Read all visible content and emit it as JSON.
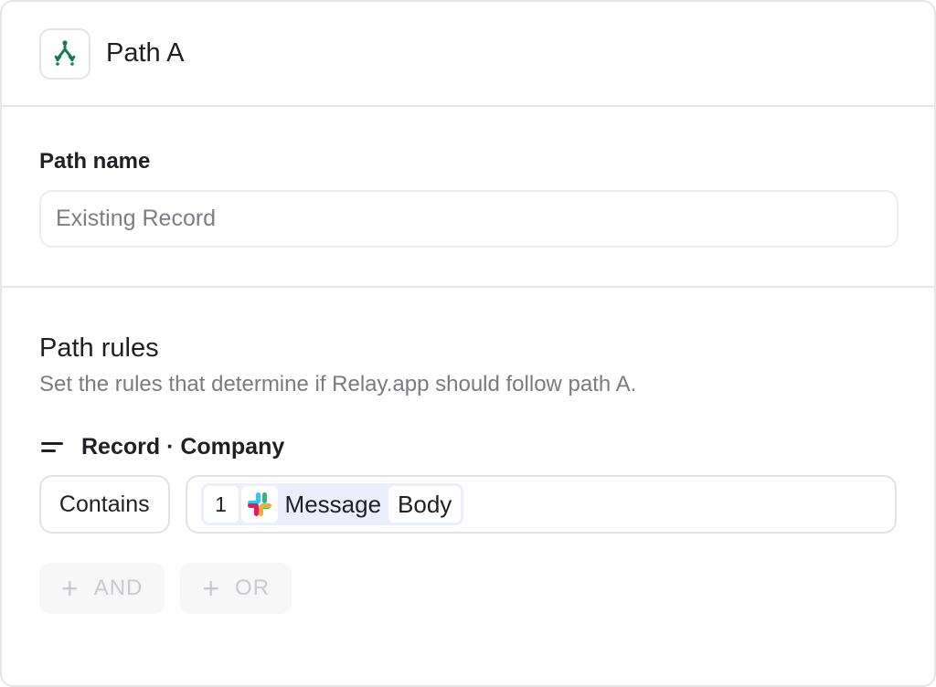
{
  "header": {
    "title": "Path A",
    "icon": "path-split-icon"
  },
  "path_name": {
    "label": "Path name",
    "placeholder": "Existing Record",
    "value": ""
  },
  "path_rules": {
    "title": "Path rules",
    "description": "Set the rules that determine if Relay.app should follow path A.",
    "field": {
      "icon": "field-lines-icon",
      "label": "Record · Company"
    },
    "operator": "Contains",
    "value_token": {
      "step": "1",
      "app_icon": "slack-icon",
      "label": "Message",
      "property": "Body"
    },
    "add_and": "AND",
    "add_or": "OR"
  },
  "colors": {
    "accent": "#137a54",
    "token_bg": "#eceefe",
    "border": "#e2e2e6",
    "muted_text": "#7a7a82"
  }
}
